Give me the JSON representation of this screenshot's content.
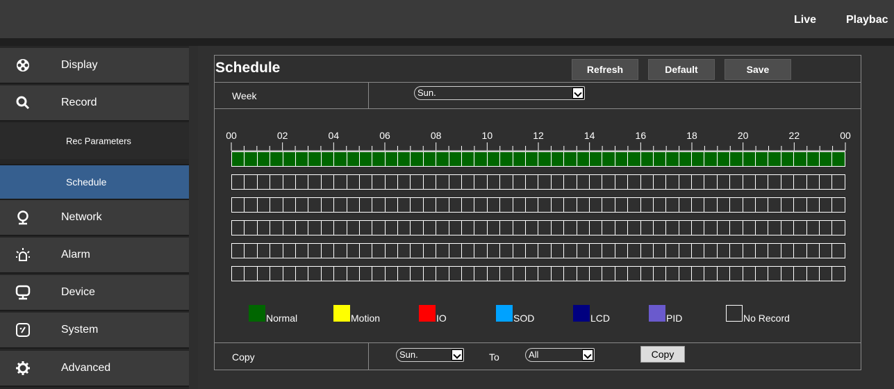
{
  "topnav": {
    "live": "Live",
    "playback": "Playbac"
  },
  "sidebar": {
    "items": [
      {
        "label": "Display",
        "icon": "film-reel-icon"
      },
      {
        "label": "Record",
        "icon": "search-icon"
      },
      {
        "label": "Rec Parameters"
      },
      {
        "label": "Schedule"
      },
      {
        "label": "Network",
        "icon": "globe-icon"
      },
      {
        "label": "Alarm",
        "icon": "alarm-light-icon"
      },
      {
        "label": "Device",
        "icon": "monitor-icon"
      },
      {
        "label": "System",
        "icon": "system-icon"
      },
      {
        "label": "Advanced",
        "icon": "gear-icon"
      }
    ]
  },
  "schedule": {
    "title": "Schedule",
    "buttons": {
      "refresh": "Refresh",
      "default": "Default",
      "save": "Save"
    },
    "week_label": "Week",
    "week_value": "Sun.",
    "hours": [
      "00",
      "02",
      "04",
      "06",
      "08",
      "10",
      "12",
      "14",
      "16",
      "18",
      "20",
      "22",
      "00"
    ],
    "rows": [
      {
        "type": "Normal",
        "filled": true
      },
      {
        "type": "No Record",
        "filled": false
      },
      {
        "type": "No Record",
        "filled": false
      },
      {
        "type": "No Record",
        "filled": false
      },
      {
        "type": "No Record",
        "filled": false
      },
      {
        "type": "No Record",
        "filled": false
      }
    ],
    "cells_per_row": 48,
    "legend": [
      {
        "label": "Normal",
        "color": "#006600"
      },
      {
        "label": "Motion",
        "color": "#ffff00"
      },
      {
        "label": "IO",
        "color": "#ff0000"
      },
      {
        "label": "SOD",
        "color": "#00a2ff"
      },
      {
        "label": "LCD",
        "color": "#000080"
      },
      {
        "label": "PID",
        "color": "#6a5acd"
      },
      {
        "label": "No Record",
        "color": "#ffffff"
      }
    ],
    "copy_label": "Copy",
    "copy_from": "Sun.",
    "to_label": "To",
    "copy_to": "All",
    "copy_button": "Copy"
  }
}
